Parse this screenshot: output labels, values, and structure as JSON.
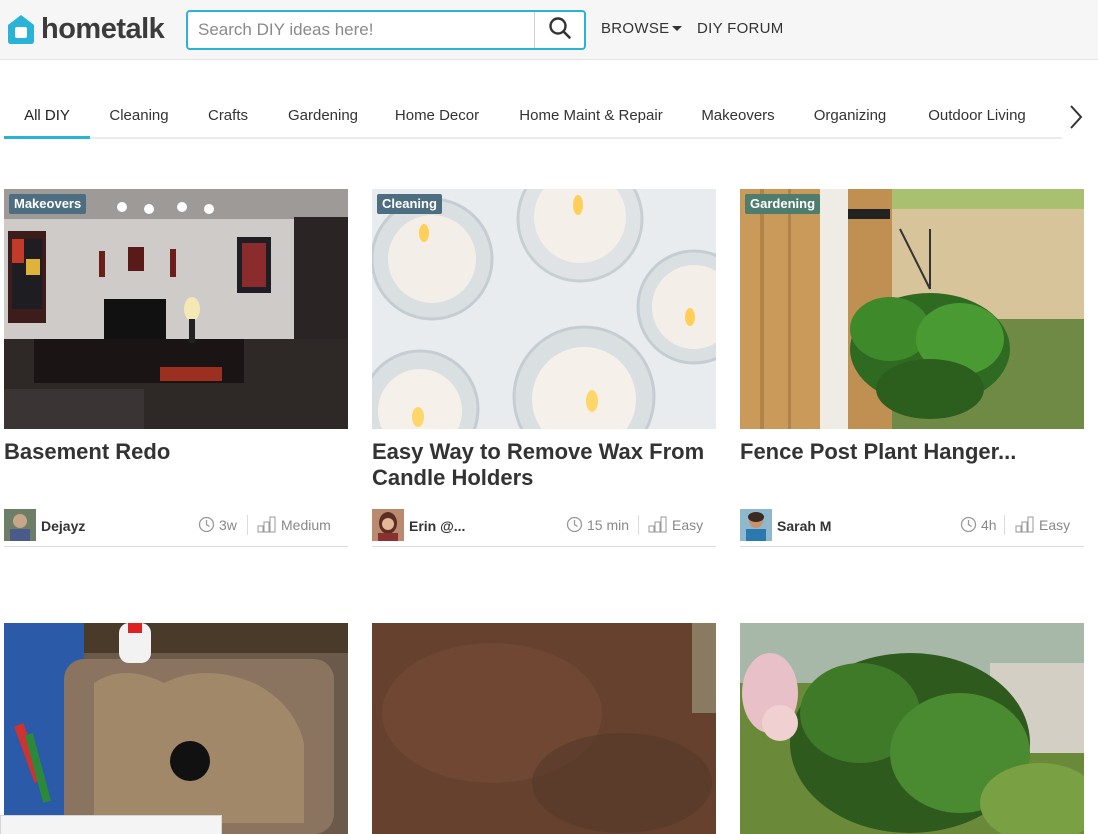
{
  "header": {
    "logo_text": "hometalk",
    "search_placeholder": "Search DIY ideas here!",
    "browse_label": "BROWSE",
    "forum_label": "DIY FORUM"
  },
  "tabs": [
    {
      "label": "All DIY",
      "active": true
    },
    {
      "label": "Cleaning"
    },
    {
      "label": "Crafts"
    },
    {
      "label": "Gardening"
    },
    {
      "label": "Home Decor"
    },
    {
      "label": "Home Maint & Repair"
    },
    {
      "label": "Makeovers"
    },
    {
      "label": "Organizing"
    },
    {
      "label": "Outdoor Living"
    }
  ],
  "cards": [
    {
      "category": "Makeovers",
      "title": "Basement Redo",
      "author": "Dejayz",
      "time": "3w",
      "difficulty": "Medium"
    },
    {
      "category": "Cleaning",
      "title": "Easy Way to Remove Wax From Candle Holders",
      "author": "Erin @...",
      "time": "15 min",
      "difficulty": "Easy"
    },
    {
      "category": "Gardening",
      "title": "Fence Post Plant Hanger...",
      "author": "Sarah M",
      "time": "4h",
      "difficulty": "Easy"
    }
  ],
  "colors": {
    "accent": "#29b3d6",
    "badge": "#4d6d80"
  },
  "icons": {
    "search": "search-icon",
    "clock": "clock-icon",
    "difficulty": "difficulty-bars-icon",
    "next": "chevron-right-icon"
  }
}
